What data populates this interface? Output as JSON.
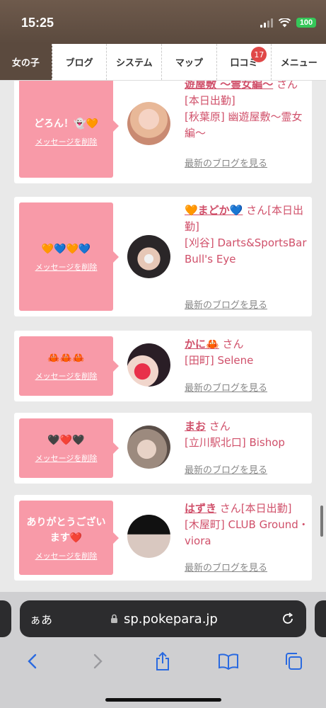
{
  "status": {
    "time": "15:25",
    "battery": "100"
  },
  "nav": {
    "tabs": [
      {
        "label": "女の子"
      },
      {
        "label": "ブログ"
      },
      {
        "label": "システム"
      },
      {
        "label": "マップ"
      },
      {
        "label": "口コミ",
        "badge": "17"
      },
      {
        "label": "メニュー"
      }
    ]
  },
  "cards": [
    {
      "message": "どろん！👻🧡",
      "delete_label": "メッセージを削除",
      "name": "遊屋敷 〜霊女編〜",
      "suffix": "さん[本日出勤]",
      "location": "[秋葉原] 幽遊屋敷〜霊女編〜",
      "blog_link": "最新のブログを見る"
    },
    {
      "message": "🧡💙🧡💙",
      "delete_label": "メッセージを削除",
      "name": "🧡まどか💙",
      "suffix": "さん[本日出勤]",
      "location": "[刈谷] Darts&SportsBar Bull's Eye",
      "blog_link": "最新のブログを見る"
    },
    {
      "message": "🦀🦀🦀",
      "delete_label": "メッセージを削除",
      "name": "かに🦀",
      "suffix": "さん",
      "location": "[田町] Selene",
      "blog_link": "最新のブログを見る"
    },
    {
      "message": "🖤❤️🖤",
      "delete_label": "メッセージを削除",
      "name": "まお",
      "suffix": "さん",
      "location": "[立川駅北口] Bishop",
      "blog_link": "最新のブログを見る"
    },
    {
      "message": "ありがとうございます❤️",
      "delete_label": "メッセージを削除",
      "name": "はずき",
      "suffix": "さん[本日出勤]",
      "location": "[木屋町] CLUB Ground・viora",
      "blog_link": "最新のブログを見る"
    }
  ],
  "browser": {
    "aa_label": "ぁあ",
    "url": "sp.pokepara.jp"
  },
  "icons": {
    "wifi": "wifi-icon",
    "lock": "lock-icon",
    "reload": "reload-icon",
    "back": "back-icon",
    "forward": "forward-icon",
    "share": "share-icon",
    "bookmarks": "book-icon",
    "tabs": "tabs-icon"
  },
  "colors": {
    "accent_pink": "#f89aa8",
    "name_pink": "#d0506a",
    "nav_active": "#5b4a3e"
  }
}
